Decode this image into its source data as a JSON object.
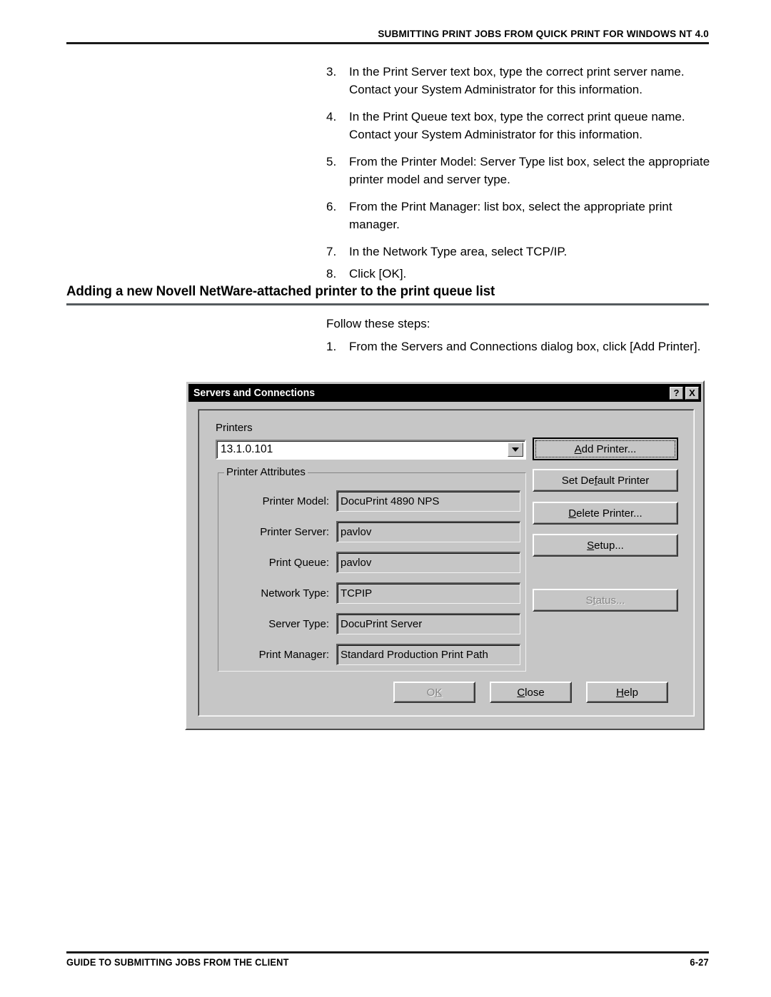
{
  "header": {
    "title": "SUBMITTING PRINT JOBS FROM QUICK PRINT FOR WINDOWS NT 4.0"
  },
  "steps_top": [
    {
      "num": "3.",
      "text": "In the Print Server text box, type the correct print server name. Contact your System Administrator for this information."
    },
    {
      "num": "4.",
      "text": "In the Print Queue text box, type the correct print queue name. Contact your System Administrator for this information."
    },
    {
      "num": "5.",
      "text": "From the Printer Model: Server Type list box, select the appropriate printer model and server type."
    },
    {
      "num": "6.",
      "text": "From the Print Manager: list box, select the appropriate print manager."
    },
    {
      "num": "7.",
      "text": "In the Network Type area, select TCP/IP."
    },
    {
      "num": "8.",
      "text": "Click [OK]."
    }
  ],
  "section": {
    "heading": "Adding a new Novell NetWare-attached printer to the print queue list",
    "intro": "Follow these steps:",
    "steps": [
      {
        "num": "1.",
        "text": "From the Servers and Connections dialog box, click [Add Printer]."
      }
    ]
  },
  "dialog": {
    "title": "Servers and Connections",
    "titlebar_buttons": [
      {
        "icon": "help-question-icon",
        "label": "?"
      },
      {
        "icon": "close-x-icon",
        "label": "X"
      }
    ],
    "printers_label": "Printers",
    "printers_value": "13.1.0.101",
    "group_legend": "Printer Attributes",
    "fields": [
      {
        "label": "Printer Model:",
        "value": "DocuPrint 4890 NPS"
      },
      {
        "label": "Printer Server:",
        "value": "pavlov"
      },
      {
        "label": "Print Queue:",
        "value": "pavlov"
      },
      {
        "label": "Network Type:",
        "value": "TCPIP"
      },
      {
        "label": "Server Type:",
        "value": "DocuPrint Server"
      },
      {
        "label": "Print Manager:",
        "value": "Standard Production Print Path"
      }
    ],
    "side_buttons": [
      {
        "label": "Add Printer...",
        "accel_index": 0,
        "state": "focused"
      },
      {
        "label": "Set Default Printer",
        "accel_index": 6,
        "state": "enabled"
      },
      {
        "label": "Delete Printer...",
        "accel_index": 0,
        "state": "enabled"
      },
      {
        "label": "Setup...",
        "accel_index": 0,
        "state": "enabled"
      },
      {
        "label": "Status...",
        "accel_index": 1,
        "state": "disabled"
      }
    ],
    "bottom_buttons": [
      {
        "label": "OK",
        "accel_index": 1,
        "state": "disabled"
      },
      {
        "label": "Close",
        "accel_index": 0,
        "state": "enabled"
      },
      {
        "label": "Help",
        "accel_index": 0,
        "state": "enabled"
      }
    ]
  },
  "footer": {
    "text": "GUIDE TO SUBMITTING JOBS FROM THE CLIENT",
    "page": "6-27"
  }
}
